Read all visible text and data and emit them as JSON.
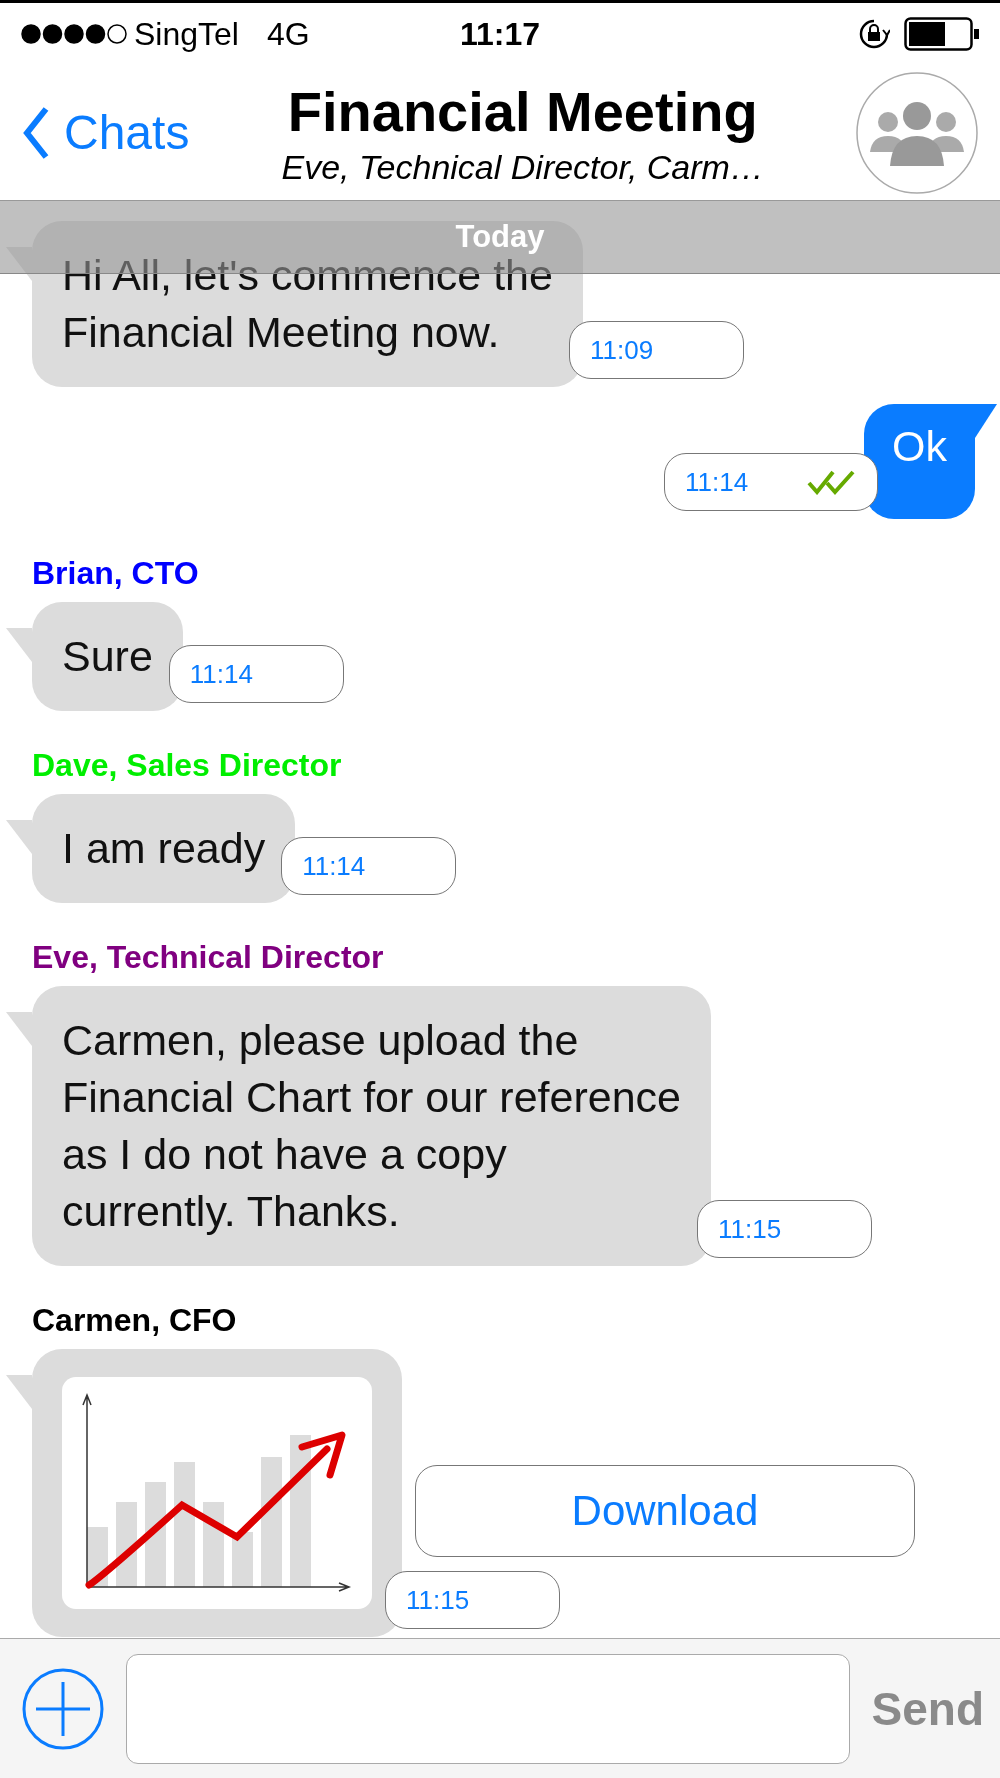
{
  "status_bar": {
    "carrier": "SingTel",
    "network": "4G",
    "time": "11:17"
  },
  "header": {
    "back": "Chats",
    "title": "Financial Meeting",
    "subtitle": "Eve, Technical Director, Carm…"
  },
  "date_banner": "Today",
  "messages": [
    {
      "kind": "incoming",
      "text": "Hi All, let's commence the\nFinancial Meeting now.",
      "time": "11:09"
    },
    {
      "kind": "outgoing",
      "text": "Ok",
      "time": "11:14",
      "read": true
    },
    {
      "kind": "incoming",
      "sender": "Brian, CTO",
      "color": "#0000ff",
      "text": "Sure",
      "time": "11:14"
    },
    {
      "kind": "incoming",
      "sender": "Dave, Sales Director",
      "color": "#00ee00",
      "text": "I am ready",
      "time": "11:14"
    },
    {
      "kind": "incoming",
      "sender": "Eve, Technical Director",
      "color": "#800080",
      "text": "Carmen, please upload the\nFinancial Chart for our reference\nas I do not have a copy\ncurrently. Thanks.",
      "time": "11:15"
    },
    {
      "kind": "image",
      "sender": "Carmen, CFO",
      "color": "#000000",
      "action": "Download",
      "time": "11:15"
    }
  ],
  "composer": {
    "send": "Send",
    "send_disabled": true
  }
}
